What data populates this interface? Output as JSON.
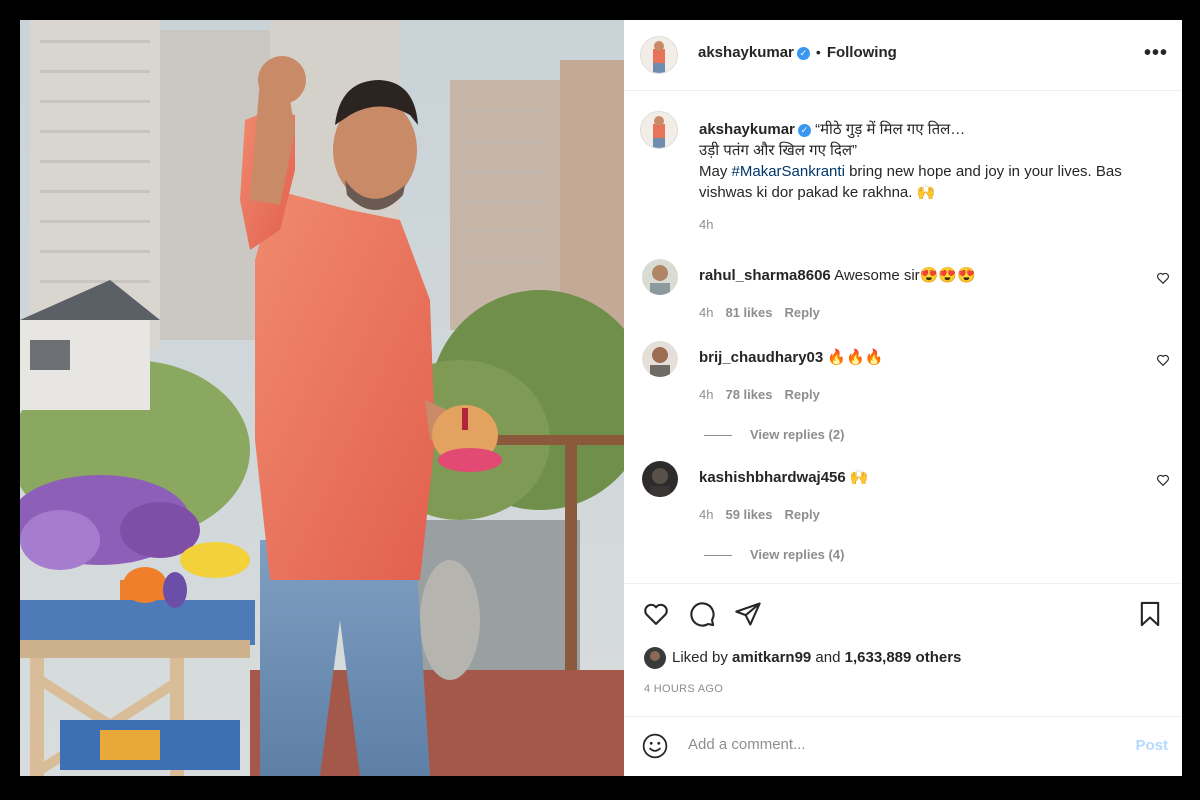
{
  "post": {
    "author": "akshaykumar",
    "following_label": "Following",
    "caption_line1": "“मीठे गुड़ में मिल गए तिल…",
    "caption_line2": "उड़ी पतंग और खिल गए दिल”",
    "caption_pre": "May ",
    "caption_hashtag": "#MakarSankranti",
    "caption_post1": " bring new hope and joy in your lives. Bas",
    "caption_line4": "vishwas ki dor pakad ke rakhna. 🙌",
    "caption_time": "4h"
  },
  "comments": [
    {
      "user": "rahul_sharma8606",
      "text": "Awesome sir😍😍😍",
      "time": "4h",
      "likes": "81 likes",
      "reply": "Reply"
    },
    {
      "user": "brij_chaudhary03",
      "text": "🔥🔥🔥",
      "time": "4h",
      "likes": "78 likes",
      "reply": "Reply",
      "view_replies": "View replies (2)"
    },
    {
      "user": "kashishbhardwaj456",
      "text": "🙌",
      "time": "4h",
      "likes": "59 likes",
      "reply": "Reply",
      "view_replies": "View replies (4)"
    }
  ],
  "likes": {
    "prefix": "Liked by ",
    "user": "amitkarn99",
    "middle": " and ",
    "count": "1,633,889 others"
  },
  "timestamp": "4 HOURS AGO",
  "add_comment": {
    "placeholder": "Add a comment...",
    "post_label": "Post"
  },
  "icons": {
    "heart": "heart-icon",
    "comment": "comment-icon",
    "share": "share-icon",
    "save": "bookmark-icon",
    "emoji": "emoji-icon",
    "more": "more-icon",
    "verified": "verified-badge-icon"
  },
  "colors": {
    "accent": "#3897f0",
    "hashtag": "#00376b",
    "muted": "#8e8e8e",
    "post_disabled": "#b3dbff"
  }
}
